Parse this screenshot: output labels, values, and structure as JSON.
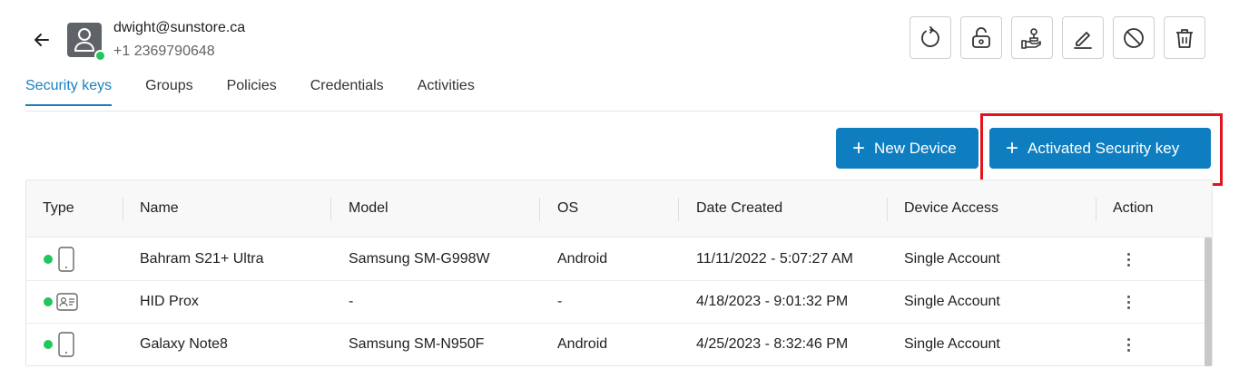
{
  "user": {
    "email": "dwight@sunstore.ca",
    "phone": "+1 2369790648",
    "status_color": "#22c55e"
  },
  "toolbar": {
    "buttons": [
      "refresh-icon",
      "unlock-icon",
      "hand-stamp-icon",
      "edit-icon",
      "block-icon",
      "delete-icon"
    ]
  },
  "tabs": [
    {
      "label": "Security keys",
      "active": true
    },
    {
      "label": "Groups",
      "active": false
    },
    {
      "label": "Policies",
      "active": false
    },
    {
      "label": "Credentials",
      "active": false
    },
    {
      "label": "Activities",
      "active": false
    }
  ],
  "actions": {
    "new_device": "New Device",
    "activated_security_key": "Activated Security key",
    "plus": "+"
  },
  "table": {
    "columns": [
      "Type",
      "Name",
      "Model",
      "OS",
      "Date Created",
      "Device Access",
      "Action"
    ],
    "rows": [
      {
        "type_icon": "phone-icon",
        "name": "Bahram S21+ Ultra",
        "model": "Samsung SM-G998W",
        "os": "Android",
        "date_created": "11/11/2022 - 5:07:27 AM",
        "device_access": "Single Account"
      },
      {
        "type_icon": "id-card-icon",
        "name": "HID Prox",
        "model": "-",
        "os": "-",
        "date_created": "4/18/2023 - 9:01:32 PM",
        "device_access": "Single Account"
      },
      {
        "type_icon": "phone-icon",
        "name": "Galaxy Note8",
        "model": "Samsung SM-N950F",
        "os": "Android",
        "date_created": "4/25/2023 - 8:32:46 PM",
        "device_access": "Single Account"
      }
    ]
  },
  "colors": {
    "accent": "#0f7ec0",
    "tab_active": "#1a7fc1",
    "highlight": "#e3141c",
    "online": "#22c55e"
  }
}
